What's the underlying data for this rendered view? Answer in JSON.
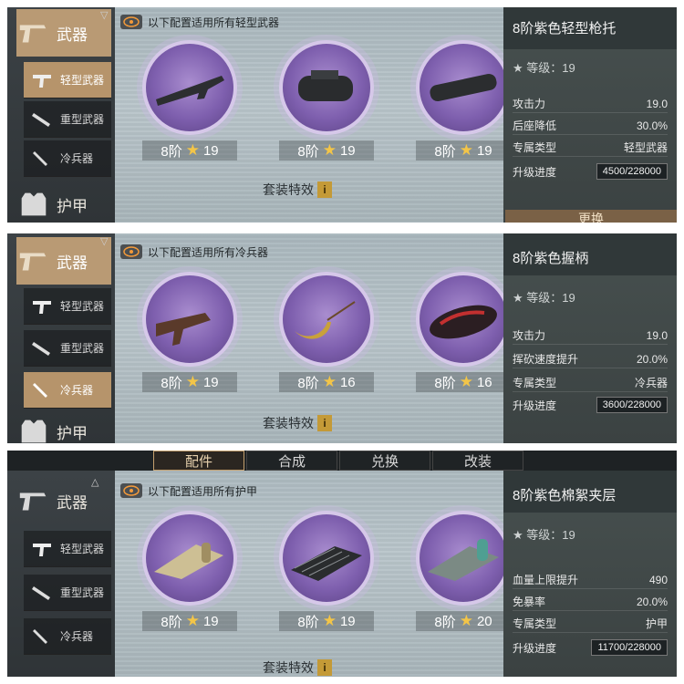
{
  "panels": [
    {
      "category": "武器",
      "subs": [
        "轻型武器",
        "重型武器",
        "冷兵器"
      ],
      "active_sub": 0,
      "next_category": "护甲",
      "info": "以下配置适用所有轻型武器",
      "items": [
        {
          "grade": "8阶",
          "stars": "19"
        },
        {
          "grade": "8阶",
          "stars": "19"
        },
        {
          "grade": "8阶",
          "stars": "19"
        }
      ],
      "set_label": "套装特效",
      "detail": {
        "title": "8阶紫色轻型枪托",
        "rating": "★ 等级：19",
        "stats": [
          {
            "label": "攻击力",
            "value": "19.0"
          },
          {
            "label": "后座降低",
            "value": "30.0%"
          },
          {
            "label": "专属类型",
            "value": "轻型武器"
          }
        ],
        "progress_label": "升级进度",
        "progress_value": "4500/228000",
        "button": "更换"
      }
    },
    {
      "category": "武器",
      "subs": [
        "轻型武器",
        "重型武器",
        "冷兵器"
      ],
      "active_sub": 2,
      "next_category": "护甲",
      "info": "以下配置适用所有冷兵器",
      "items": [
        {
          "grade": "8阶",
          "stars": "19"
        },
        {
          "grade": "8阶",
          "stars": "16"
        },
        {
          "grade": "8阶",
          "stars": "16"
        }
      ],
      "set_label": "套装特效",
      "detail": {
        "title": "8阶紫色握柄",
        "rating": "★ 等级：19",
        "stats": [
          {
            "label": "攻击力",
            "value": "19.0"
          },
          {
            "label": "挥砍速度提升",
            "value": "20.0%"
          },
          {
            "label": "专属类型",
            "value": "冷兵器"
          }
        ],
        "progress_label": "升级进度",
        "progress_value": "3600/228000"
      }
    },
    {
      "tabs": [
        "配件",
        "合成",
        "兑换",
        "改装"
      ],
      "category": "武器",
      "subs": [
        "轻型武器",
        "重型武器",
        "冷兵器"
      ],
      "active_sub": -1,
      "info": "以下配置适用所有护甲",
      "items": [
        {
          "grade": "8阶",
          "stars": "19"
        },
        {
          "grade": "8阶",
          "stars": "19"
        },
        {
          "grade": "8阶",
          "stars": "20"
        }
      ],
      "set_label": "套装特效",
      "detail": {
        "title": "8阶紫色棉絮夹层",
        "rating": "★ 等级：19",
        "stats": [
          {
            "label": "血量上限提升",
            "value": "490"
          },
          {
            "label": "免暴率",
            "value": "20.0%"
          },
          {
            "label": "专属类型",
            "value": "护甲"
          }
        ],
        "progress_label": "升级进度",
        "progress_value": "11700/228000"
      }
    }
  ]
}
